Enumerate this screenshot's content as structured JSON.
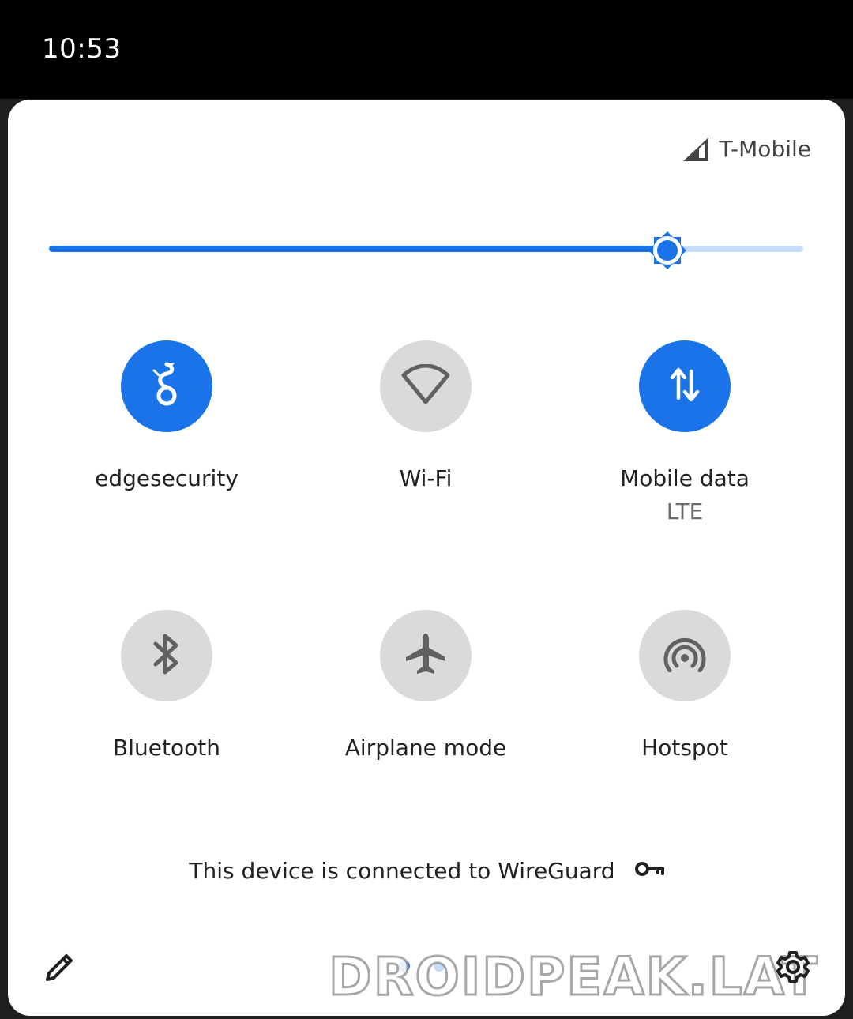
{
  "status_bar": {
    "time": "10:53"
  },
  "carrier": {
    "name": "T-Mobile",
    "icon": "signal-icon"
  },
  "brightness": {
    "level": 0.82,
    "icon": "brightness-icon"
  },
  "tiles": [
    {
      "label": "edgesecurity",
      "sublabel": "",
      "state": "on",
      "icon": "wireguard-icon"
    },
    {
      "label": "Wi-Fi",
      "sublabel": "",
      "state": "off",
      "icon": "wifi-icon"
    },
    {
      "label": "Mobile data",
      "sublabel": "LTE",
      "state": "on",
      "icon": "mobile-data-icon"
    },
    {
      "label": "Bluetooth",
      "sublabel": "",
      "state": "off",
      "icon": "bluetooth-icon"
    },
    {
      "label": "Airplane mode",
      "sublabel": "",
      "state": "off",
      "icon": "airplane-icon"
    },
    {
      "label": "Hotspot",
      "sublabel": "",
      "state": "off",
      "icon": "hotspot-icon"
    }
  ],
  "vpn": {
    "message": "This device is connected to WireGuard",
    "icon": "key-icon"
  },
  "footer": {
    "edit_icon": "pencil-icon",
    "settings_icon": "gear-icon"
  },
  "watermark": "DROIDPEAK.LAT",
  "colors": {
    "accent": "#1a73e8",
    "accent_light": "#c6dcfb",
    "tile_off": "#dadada",
    "icon_off": "#616161"
  }
}
